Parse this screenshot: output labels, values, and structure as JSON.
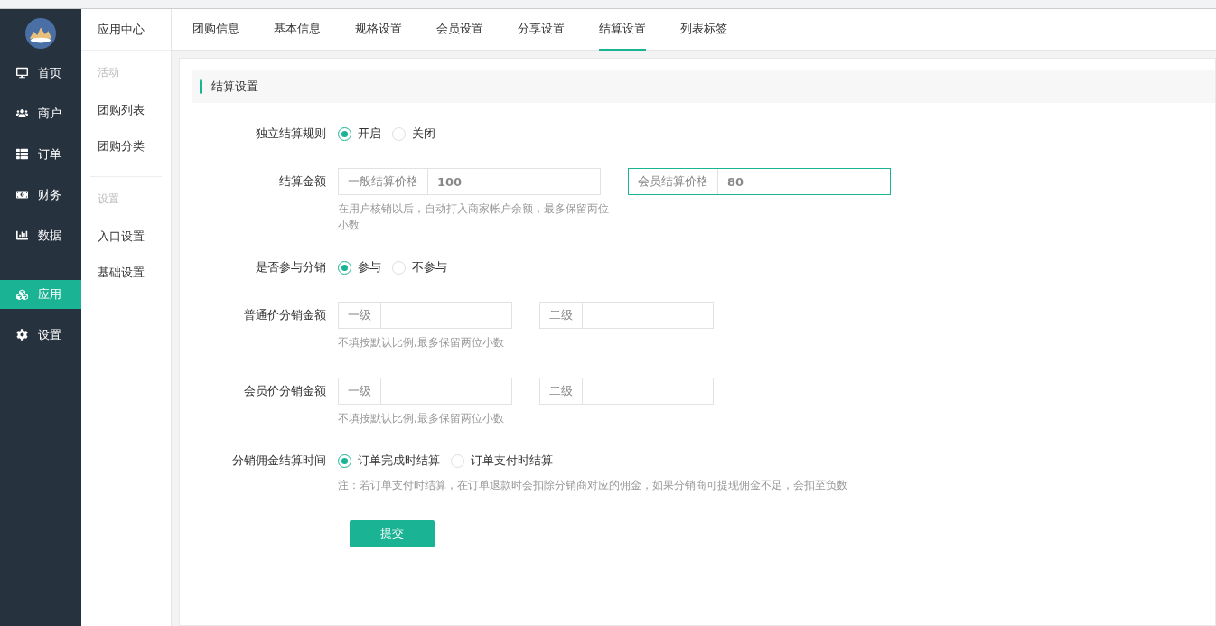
{
  "sidebar": {
    "items": [
      {
        "label": "首页",
        "selected": false
      },
      {
        "label": "商户",
        "selected": false
      },
      {
        "label": "订单",
        "selected": false
      },
      {
        "label": "财务",
        "selected": false
      },
      {
        "label": "数据",
        "selected": false
      },
      {
        "label": "应用",
        "selected": true
      },
      {
        "label": "设置",
        "selected": false
      }
    ]
  },
  "subnav": {
    "title": "应用中心",
    "groups": [
      {
        "title": "活动",
        "items": [
          {
            "label": "团购列表"
          },
          {
            "label": "团购分类"
          }
        ]
      },
      {
        "title": "设置",
        "items": [
          {
            "label": "入口设置"
          },
          {
            "label": "基础设置"
          }
        ]
      }
    ]
  },
  "tabs": [
    {
      "label": "团购信息",
      "selected": false
    },
    {
      "label": "基本信息",
      "selected": false
    },
    {
      "label": "规格设置",
      "selected": false
    },
    {
      "label": "会员设置",
      "selected": false
    },
    {
      "label": "分享设置",
      "selected": false
    },
    {
      "label": "结算设置",
      "selected": true
    },
    {
      "label": "列表标签",
      "selected": false
    }
  ],
  "section": {
    "title": "结算设置"
  },
  "fields": [
    {
      "kind": "radio",
      "label": "独立结算规则",
      "options": [
        {
          "label": "开启",
          "selected": true
        },
        {
          "label": "关闭",
          "selected": false
        }
      ]
    },
    {
      "kind": "pair",
      "label": "结算金额",
      "inputs": [
        {
          "addon": "一般结算价格",
          "value": "100",
          "focused": false
        },
        {
          "addon": "会员结算价格",
          "value": "80",
          "focused": true
        }
      ],
      "help": "在用户核销以后，自动打入商家帐户余额，最多保留两位小数"
    },
    {
      "kind": "radio",
      "label": "是否参与分销",
      "options": [
        {
          "label": "参与",
          "selected": true
        },
        {
          "label": "不参与",
          "selected": false
        }
      ]
    },
    {
      "kind": "pair",
      "label": "普通价分销金额",
      "inputs": [
        {
          "addon": "一级",
          "focused": false
        },
        {
          "addon": "二级",
          "focused": false
        }
      ],
      "help": "不填按默认比例,最多保留两位小数"
    },
    {
      "kind": "pair",
      "label": "会员价分销金额",
      "inputs": [
        {
          "addon": "一级",
          "focused": false
        },
        {
          "addon": "二级",
          "focused": false
        }
      ],
      "help": "不填按默认比例,最多保留两位小数"
    },
    {
      "kind": "radio",
      "label": "分销佣金结算时间",
      "options": [
        {
          "label": "订单完成时结算",
          "selected": true
        },
        {
          "label": "订单支付时结算",
          "selected": false
        }
      ],
      "help": "注：若订单支付时结算，在订单退款时会扣除分销商对应的佣金，如果分销商可提现佣金不足，会扣至负数"
    }
  ],
  "submit": "提交"
}
